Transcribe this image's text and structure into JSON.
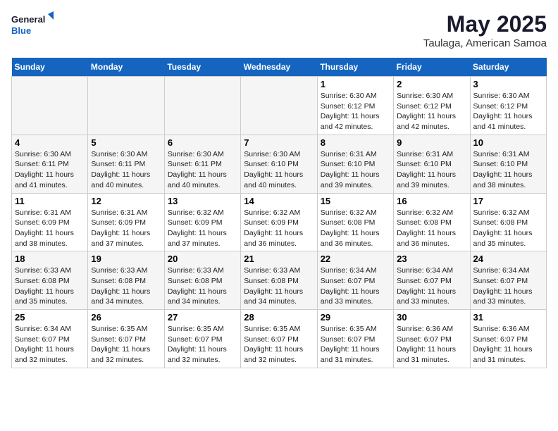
{
  "logo": {
    "line1": "General",
    "line2": "Blue"
  },
  "title": "May 2025",
  "location": "Taulaga, American Samoa",
  "days_of_week": [
    "Sunday",
    "Monday",
    "Tuesday",
    "Wednesday",
    "Thursday",
    "Friday",
    "Saturday"
  ],
  "weeks": [
    [
      {
        "day": "",
        "empty": true
      },
      {
        "day": "",
        "empty": true
      },
      {
        "day": "",
        "empty": true
      },
      {
        "day": "",
        "empty": true
      },
      {
        "day": "1",
        "sunrise": "6:30 AM",
        "sunset": "6:12 PM",
        "daylight": "11 hours and 42 minutes."
      },
      {
        "day": "2",
        "sunrise": "6:30 AM",
        "sunset": "6:12 PM",
        "daylight": "11 hours and 42 minutes."
      },
      {
        "day": "3",
        "sunrise": "6:30 AM",
        "sunset": "6:12 PM",
        "daylight": "11 hours and 41 minutes."
      }
    ],
    [
      {
        "day": "4",
        "sunrise": "6:30 AM",
        "sunset": "6:11 PM",
        "daylight": "11 hours and 41 minutes."
      },
      {
        "day": "5",
        "sunrise": "6:30 AM",
        "sunset": "6:11 PM",
        "daylight": "11 hours and 40 minutes."
      },
      {
        "day": "6",
        "sunrise": "6:30 AM",
        "sunset": "6:11 PM",
        "daylight": "11 hours and 40 minutes."
      },
      {
        "day": "7",
        "sunrise": "6:30 AM",
        "sunset": "6:10 PM",
        "daylight": "11 hours and 40 minutes."
      },
      {
        "day": "8",
        "sunrise": "6:31 AM",
        "sunset": "6:10 PM",
        "daylight": "11 hours and 39 minutes."
      },
      {
        "day": "9",
        "sunrise": "6:31 AM",
        "sunset": "6:10 PM",
        "daylight": "11 hours and 39 minutes."
      },
      {
        "day": "10",
        "sunrise": "6:31 AM",
        "sunset": "6:10 PM",
        "daylight": "11 hours and 38 minutes."
      }
    ],
    [
      {
        "day": "11",
        "sunrise": "6:31 AM",
        "sunset": "6:09 PM",
        "daylight": "11 hours and 38 minutes."
      },
      {
        "day": "12",
        "sunrise": "6:31 AM",
        "sunset": "6:09 PM",
        "daylight": "11 hours and 37 minutes."
      },
      {
        "day": "13",
        "sunrise": "6:32 AM",
        "sunset": "6:09 PM",
        "daylight": "11 hours and 37 minutes."
      },
      {
        "day": "14",
        "sunrise": "6:32 AM",
        "sunset": "6:09 PM",
        "daylight": "11 hours and 36 minutes."
      },
      {
        "day": "15",
        "sunrise": "6:32 AM",
        "sunset": "6:08 PM",
        "daylight": "11 hours and 36 minutes."
      },
      {
        "day": "16",
        "sunrise": "6:32 AM",
        "sunset": "6:08 PM",
        "daylight": "11 hours and 36 minutes."
      },
      {
        "day": "17",
        "sunrise": "6:32 AM",
        "sunset": "6:08 PM",
        "daylight": "11 hours and 35 minutes."
      }
    ],
    [
      {
        "day": "18",
        "sunrise": "6:33 AM",
        "sunset": "6:08 PM",
        "daylight": "11 hours and 35 minutes."
      },
      {
        "day": "19",
        "sunrise": "6:33 AM",
        "sunset": "6:08 PM",
        "daylight": "11 hours and 34 minutes."
      },
      {
        "day": "20",
        "sunrise": "6:33 AM",
        "sunset": "6:08 PM",
        "daylight": "11 hours and 34 minutes."
      },
      {
        "day": "21",
        "sunrise": "6:33 AM",
        "sunset": "6:08 PM",
        "daylight": "11 hours and 34 minutes."
      },
      {
        "day": "22",
        "sunrise": "6:34 AM",
        "sunset": "6:07 PM",
        "daylight": "11 hours and 33 minutes."
      },
      {
        "day": "23",
        "sunrise": "6:34 AM",
        "sunset": "6:07 PM",
        "daylight": "11 hours and 33 minutes."
      },
      {
        "day": "24",
        "sunrise": "6:34 AM",
        "sunset": "6:07 PM",
        "daylight": "11 hours and 33 minutes."
      }
    ],
    [
      {
        "day": "25",
        "sunrise": "6:34 AM",
        "sunset": "6:07 PM",
        "daylight": "11 hours and 32 minutes."
      },
      {
        "day": "26",
        "sunrise": "6:35 AM",
        "sunset": "6:07 PM",
        "daylight": "11 hours and 32 minutes."
      },
      {
        "day": "27",
        "sunrise": "6:35 AM",
        "sunset": "6:07 PM",
        "daylight": "11 hours and 32 minutes."
      },
      {
        "day": "28",
        "sunrise": "6:35 AM",
        "sunset": "6:07 PM",
        "daylight": "11 hours and 32 minutes."
      },
      {
        "day": "29",
        "sunrise": "6:35 AM",
        "sunset": "6:07 PM",
        "daylight": "11 hours and 31 minutes."
      },
      {
        "day": "30",
        "sunrise": "6:36 AM",
        "sunset": "6:07 PM",
        "daylight": "11 hours and 31 minutes."
      },
      {
        "day": "31",
        "sunrise": "6:36 AM",
        "sunset": "6:07 PM",
        "daylight": "11 hours and 31 minutes."
      }
    ]
  ],
  "labels": {
    "sunrise": "Sunrise:",
    "sunset": "Sunset:",
    "daylight": "Daylight:"
  }
}
